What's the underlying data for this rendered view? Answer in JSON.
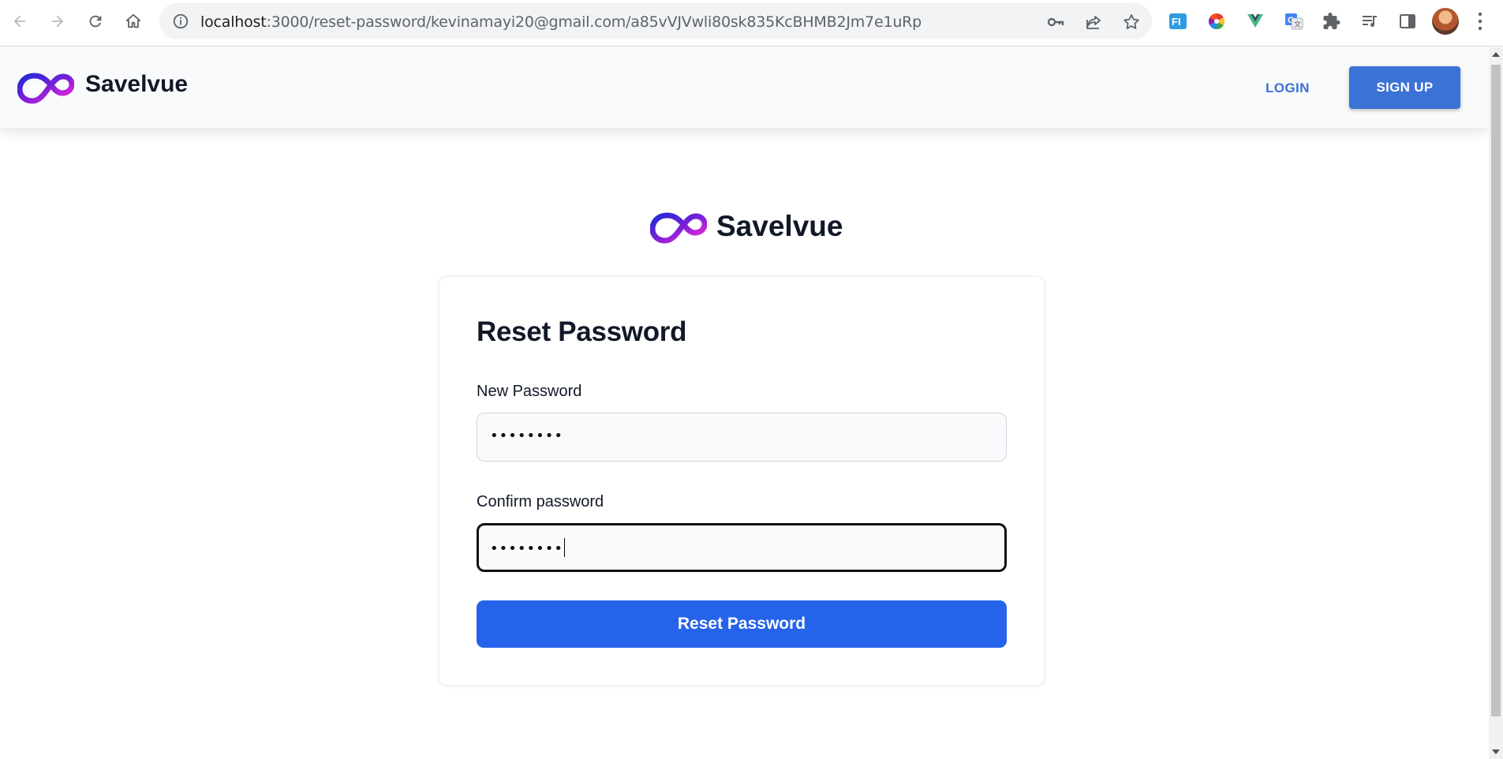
{
  "browser": {
    "url_host": "localhost",
    "url_rest": ":3000/reset-password/kevinamayi20@gmail.com/a85vVJVwli80sk835KcBHMB2Jm7e1uRp",
    "icons": [
      "back-icon",
      "forward-icon",
      "reload-icon",
      "home-icon",
      "site-info-icon",
      "key-icon",
      "share-icon",
      "star-icon",
      "extensions-icon",
      "reading-list-icon",
      "side-panel-icon",
      "profile-avatar",
      "menu-icon"
    ]
  },
  "header": {
    "brand": "Savelvue",
    "login": "LOGIN",
    "signup": "SIGN UP"
  },
  "main": {
    "brand": "Savelvue"
  },
  "form": {
    "title": "Reset Password",
    "new_password_label": "New Password",
    "new_password_value": "••••••••",
    "confirm_password_label": "Confirm password",
    "confirm_password_value": "••••••••",
    "submit": "Reset Password"
  },
  "colors": {
    "primary_button": "#2563eb",
    "signup_button": "#3b72d6",
    "login_link": "#3b6fd4",
    "heading": "#111827"
  }
}
